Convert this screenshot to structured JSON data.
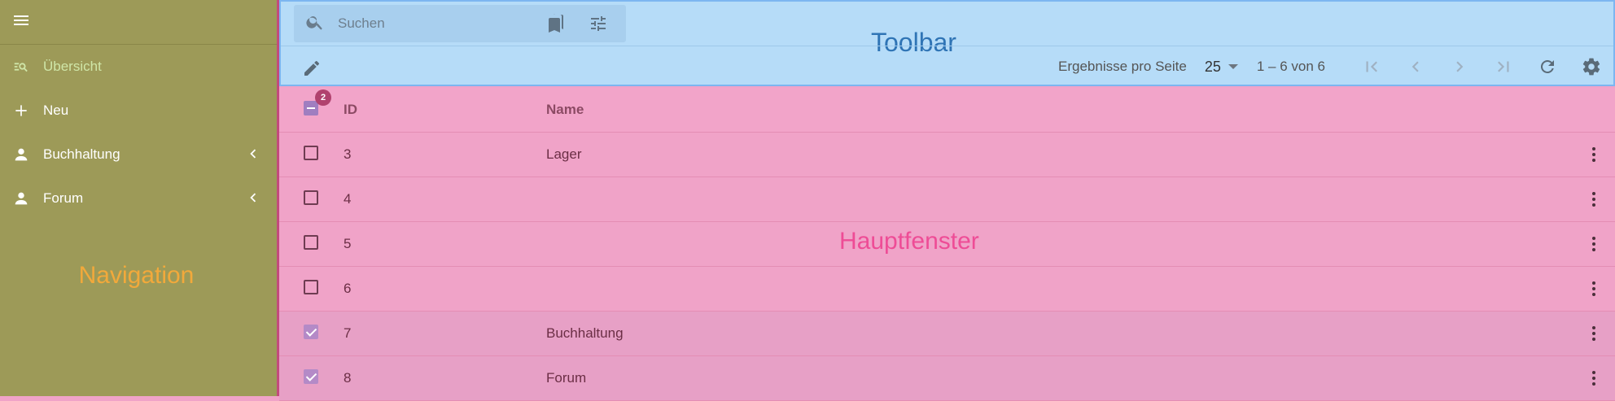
{
  "nav": {
    "items": [
      {
        "label": "Übersicht",
        "icon": "manage-search-icon"
      },
      {
        "label": "Neu",
        "icon": "plus-icon"
      },
      {
        "label": "Buchhaltung",
        "icon": "person-icon"
      },
      {
        "label": "Forum",
        "icon": "person-icon"
      }
    ],
    "overlay_label": "Navigation"
  },
  "toolbar": {
    "search_placeholder": "Suchen",
    "overlay_label": "Toolbar",
    "pager": {
      "rows_label": "Ergebnisse pro Seite",
      "page_size": "25",
      "range": "1 – 6 von 6"
    }
  },
  "table": {
    "selected_count": "2",
    "columns": [
      "ID",
      "Name"
    ],
    "rows": [
      {
        "id": "3",
        "name": "Lager",
        "checked": false
      },
      {
        "id": "4",
        "name": "",
        "checked": false
      },
      {
        "id": "5",
        "name": "",
        "checked": false
      },
      {
        "id": "6",
        "name": "",
        "checked": false
      },
      {
        "id": "7",
        "name": "Buchhaltung",
        "checked": true
      },
      {
        "id": "8",
        "name": "Forum",
        "checked": true
      }
    ]
  },
  "main_overlay_label": "Hauptfenster",
  "colors": {
    "navigation": "#9d9a58",
    "toolbar": "#b6dcf8",
    "main": "#f0a3c8"
  }
}
